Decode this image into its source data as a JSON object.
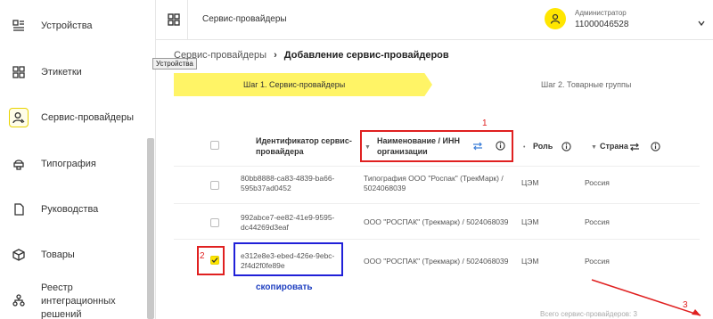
{
  "sidebar": {
    "items": [
      {
        "label": "Устройства",
        "icon": "devices-icon"
      },
      {
        "label": "Этикетки",
        "icon": "labels-icon"
      },
      {
        "label": "Сервис-провайдеры",
        "icon": "service-provider-icon"
      },
      {
        "label": "Типография",
        "icon": "printing-icon"
      },
      {
        "label": "Руководства",
        "icon": "guides-icon"
      },
      {
        "label": "Товары",
        "icon": "products-icon"
      },
      {
        "label": "Реестр интеграционных решений",
        "icon": "registry-icon"
      }
    ],
    "tooltip": "Устройства"
  },
  "header": {
    "title": "Сервис-провайдеры",
    "role": "Администратор",
    "user_id": "11000046528"
  },
  "breadcrumb": {
    "parent": "Сервис-провайдеры",
    "current": "Добавление сервис-провайдеров"
  },
  "steps": {
    "step1": "Шаг 1. Сервис-провайдеры",
    "step2": "Шаг 2. Товарные группы"
  },
  "table": {
    "headers": {
      "id": "Идентификатор сервис-провайдера",
      "name": "Наименование / ИНН организации",
      "role": "Роль",
      "country": "Страна"
    },
    "rows": [
      {
        "id": "80bb8888-ca83-4839-ba66-595b37ad0452",
        "name": "Типография ООО \"Роспак\" (ТрекМарк) / 5024068039",
        "role": "ЦЭМ",
        "country": "Россия",
        "checked": false
      },
      {
        "id": "992abce7-ee82-41e9-9595-dc44269d3eaf",
        "name": "ООО \"РОСПАК\" (Трекмарк) / 5024068039",
        "role": "ЦЭМ",
        "country": "Россия",
        "checked": false
      },
      {
        "id": "e312e8e3-ebed-426e-9ebc-2f4d2f0fe89e",
        "name": "ООО \"РОСПАК\" (Трекмарк) / 5024068039",
        "role": "ЦЭМ",
        "country": "Россия",
        "checked": true
      }
    ],
    "total": "Всего сервис-провайдеров: 3"
  },
  "annotations": {
    "n1": "1",
    "n2": "2",
    "n3": "3",
    "copy": "скопировать"
  },
  "colors": {
    "accent": "#ffe600",
    "step_active": "#fff466",
    "annotation_red": "#e02020",
    "annotation_blue": "#2020d8"
  }
}
